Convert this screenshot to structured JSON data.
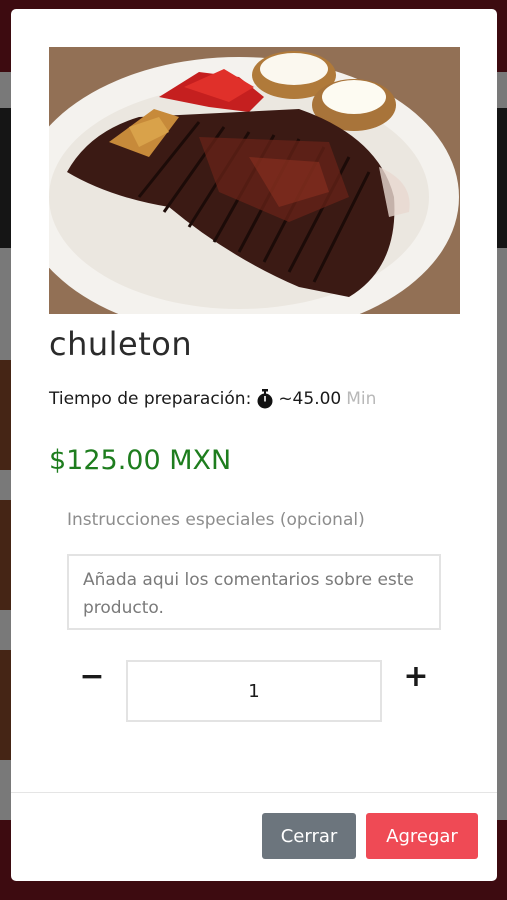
{
  "product": {
    "name": "chuleton",
    "image_icon": "steak-photo",
    "prep_label": "Tiempo de preparación:",
    "prep_icon": "stopwatch-icon",
    "prep_value": "~45.00",
    "prep_unit": "Min",
    "price": "$125.00 MXN"
  },
  "instructions": {
    "label": "Instrucciones especiales (opcional)",
    "placeholder": "Añada aqui los comentarios sobre este producto."
  },
  "quantity": {
    "minus": "−",
    "value": "1",
    "plus": "+"
  },
  "actions": {
    "close": "Cerrar",
    "add": "Agregar"
  },
  "colors": {
    "price": "#1e7d1e",
    "close_button": "#6c757d",
    "add_button": "#ef4a55",
    "brand": "#7a1620"
  }
}
